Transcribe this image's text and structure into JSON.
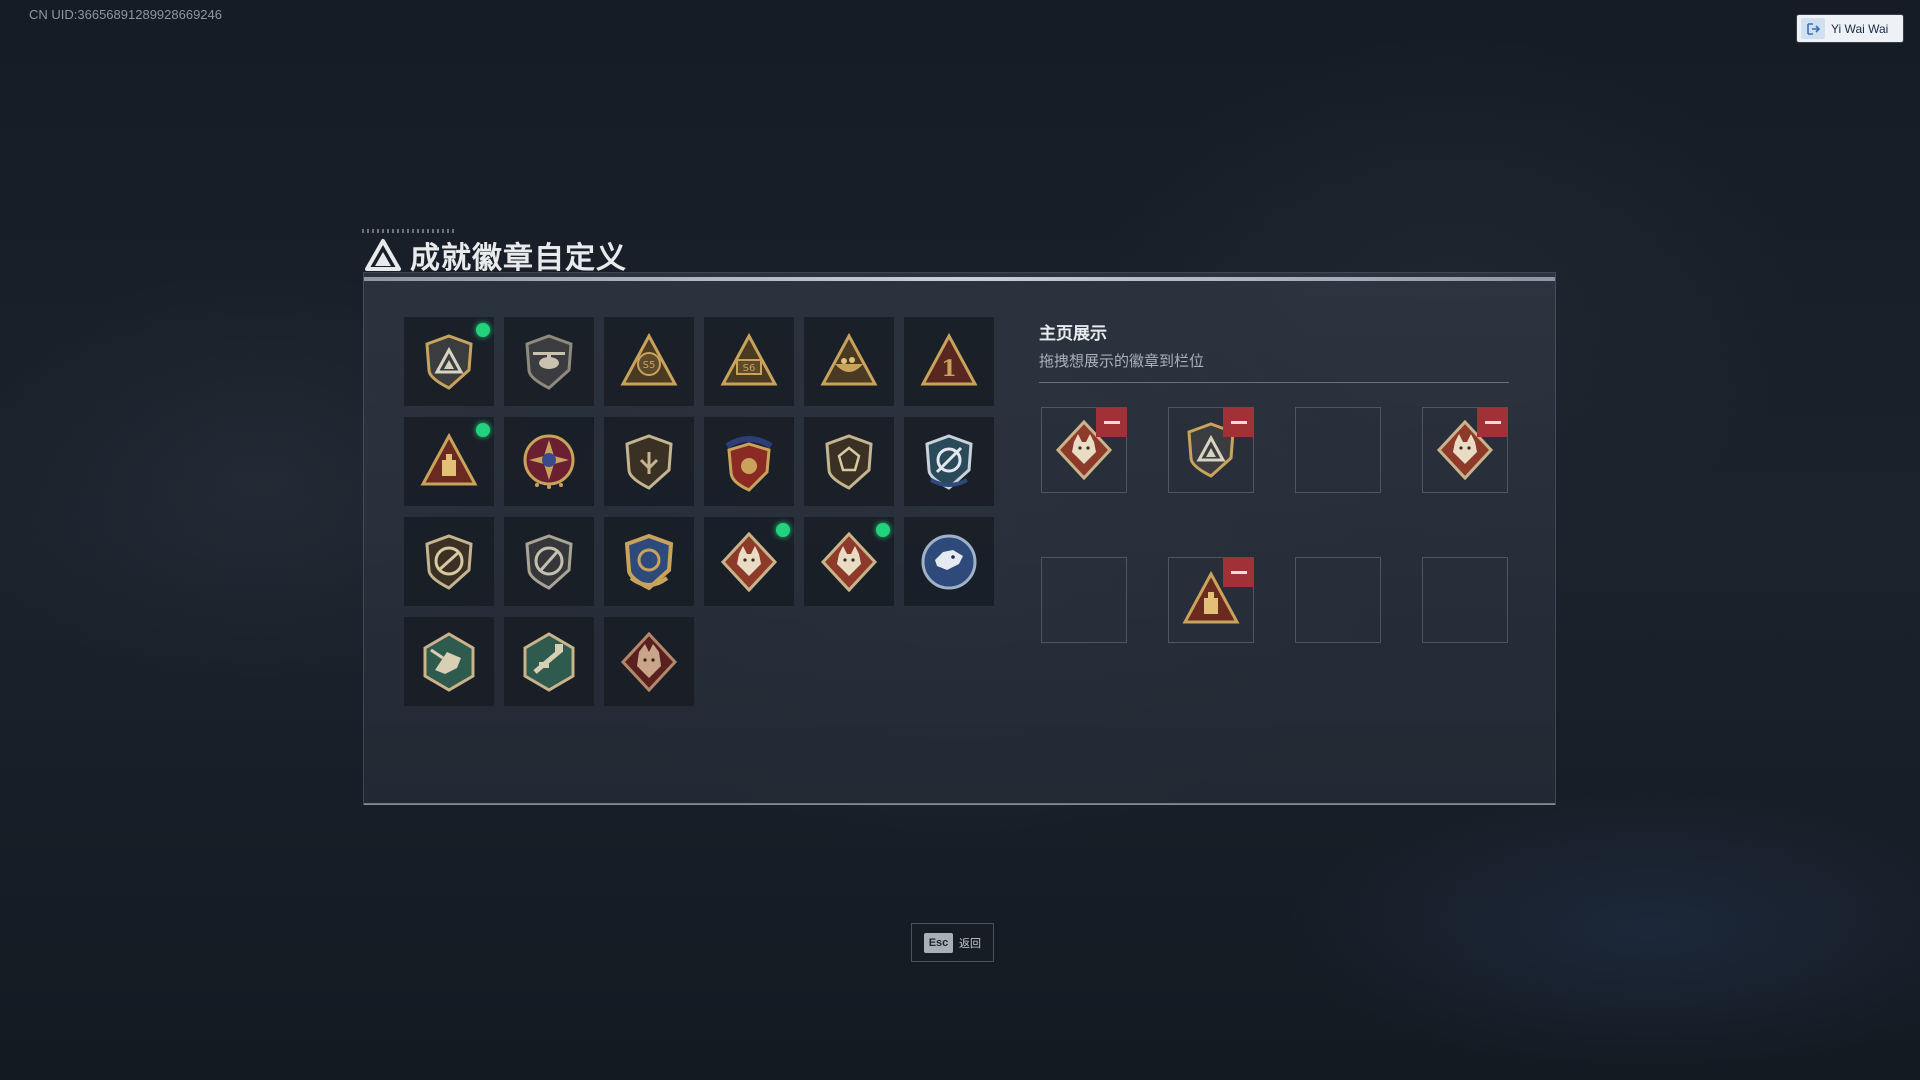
{
  "header": {
    "uid_text": "CN UID:36656891289928669246",
    "user_name": "Yi Wai Wai",
    "user_icon": "logout-icon"
  },
  "panel": {
    "title": "成就徽章自定义",
    "title_icon": "triangle-logo-icon"
  },
  "badges": [
    {
      "icon": "shield-triangle-badge",
      "new": true
    },
    {
      "icon": "helicopter-shield-badge",
      "new": false
    },
    {
      "icon": "triangle-s5-badge",
      "new": false
    },
    {
      "icon": "triangle-s6-badge",
      "new": false
    },
    {
      "icon": "triangle-bowl-badge",
      "new": false
    },
    {
      "icon": "triangle-rank-1-badge",
      "new": false
    },
    {
      "icon": "triangle-gold-bar-badge",
      "new": true
    },
    {
      "icon": "compass-star-badge",
      "new": false
    },
    {
      "icon": "shield-crest-badge",
      "new": false
    },
    {
      "icon": "eagle-crest-badge",
      "new": false
    },
    {
      "icon": "shield-gem-badge",
      "new": false
    },
    {
      "icon": "blue-target-shield-badge",
      "new": false
    },
    {
      "icon": "no-gun-shield-badge",
      "new": false
    },
    {
      "icon": "no-knife-shield-badge",
      "new": false
    },
    {
      "icon": "blue-gold-shield-badge",
      "new": false
    },
    {
      "icon": "wolf-diamond-badge",
      "new": true
    },
    {
      "icon": "wolf-diamond-badge",
      "new": true
    },
    {
      "icon": "wolf-round-badge",
      "new": false
    },
    {
      "icon": "green-hex-dragon-badge",
      "new": false
    },
    {
      "icon": "green-hex-rifle-badge",
      "new": false
    },
    {
      "icon": "dragon-diamond-badge",
      "new": false
    }
  ],
  "display": {
    "title": "主页展示",
    "subtitle": "拖拽想展示的徽章到栏位",
    "slots": [
      {
        "icon": "wolf-diamond-badge",
        "filled": true
      },
      {
        "icon": "shield-triangle-badge",
        "filled": true
      },
      {
        "icon": "",
        "filled": false
      },
      {
        "icon": "wolf-diamond-badge",
        "filled": true
      },
      {
        "icon": "",
        "filled": false
      },
      {
        "icon": "triangle-gold-bar-badge",
        "filled": true
      },
      {
        "icon": "",
        "filled": false
      },
      {
        "icon": "",
        "filled": false
      }
    ]
  },
  "footer": {
    "esc_key": "Esc",
    "esc_label": "返回"
  },
  "colors": {
    "new_dot": "#22d37e",
    "remove_button": "#a23037",
    "gold": "#c9a35c",
    "bronze": "#8e3a2a",
    "dark_red": "#5a2020",
    "teal": "#2f5a4e",
    "blue": "#2d4a7a"
  }
}
